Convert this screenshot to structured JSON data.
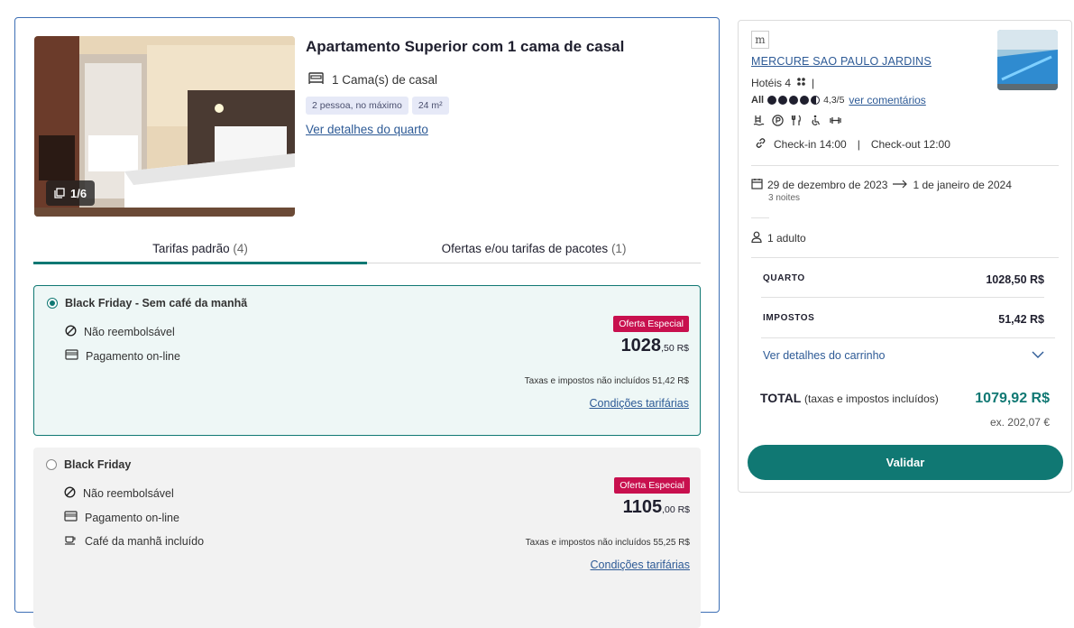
{
  "room": {
    "title": "Apartamento Superior com 1 cama de casal",
    "bed": "1 Cama(s) de casal",
    "chips": [
      "2 pessoa, no máximo",
      "24 m²"
    ],
    "details_link": "Ver detalhes do quarto",
    "photo_counter": "1/6"
  },
  "tabs": [
    {
      "label": "Tarifas padrão",
      "count": "(4)"
    },
    {
      "label": "Ofertas e/ou tarifas de pacotes",
      "count": "(1)"
    }
  ],
  "rates": [
    {
      "name": "Black Friday - Sem café da manhã",
      "features": [
        "Não reembolsável",
        "Pagamento on-line"
      ],
      "badge": "Oferta Especial",
      "price_int": "1028",
      "price_dec": ",50 R$",
      "taxes": "Taxas e impostos não incluídos 51,42 R$",
      "conditions": "Condições tarifárias"
    },
    {
      "name": "Black Friday",
      "features": [
        "Não reembolsável",
        "Pagamento on-line",
        "Café da manhã incluído"
      ],
      "badge": "Oferta Especial",
      "price_int": "1105",
      "price_dec": ",00 R$",
      "taxes": "Taxas e impostos não incluídos 55,25 R$",
      "conditions": "Condições tarifárias"
    }
  ],
  "summary": {
    "brand_logo": "m",
    "hotel_name": "MERCURE SAO PAULO JARDINS",
    "category": "Hotéis 4",
    "category_sep": "|",
    "rating_brand": "All",
    "rating_value": "4,3/5",
    "rating_score": 4.3,
    "reviews_link": "ver comentários",
    "checkin": "Check-in 14:00",
    "checkout": "Check-out 12:00",
    "checkinout_sep": "|",
    "date_from": "29 de dezembro de 2023",
    "date_to": "1 de janeiro de 2024",
    "nights": "3 noites",
    "guests": "1 adulto",
    "room_label": "QUARTO",
    "room_amount": "1028,50 R$",
    "tax_label": "IMPOSTOS",
    "tax_amount": "51,42 R$",
    "cart_link": "Ver detalhes do carrinho",
    "total_label": "TOTAL",
    "total_note": "(taxas e impostos incluídos)",
    "total_amount": "1079,92 R$",
    "ex_amount": "ex. 202,07 €",
    "validate_button": "Validar"
  },
  "colors": {
    "accent": "#107873",
    "link": "#2d5a96",
    "badge": "#c8104e",
    "card_border": "#3d6fb5"
  }
}
